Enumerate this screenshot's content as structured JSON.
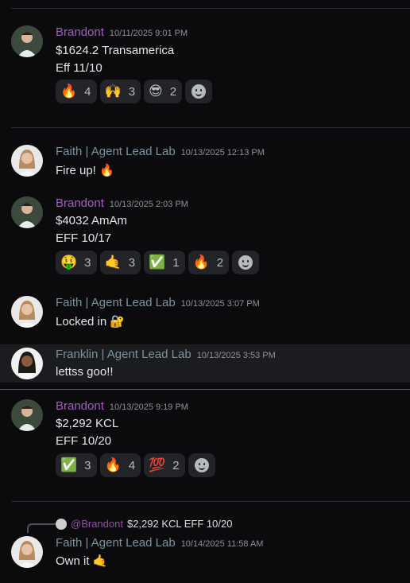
{
  "messages": [
    {
      "author": "Brandont",
      "time": "10/11/2025 9:01 PM",
      "lines": [
        "$1624.2 Transamerica",
        "Eff 11/10"
      ],
      "reactions": [
        {
          "emoji": "🔥",
          "count": "4"
        },
        {
          "emoji": "🙌",
          "count": "3"
        },
        {
          "emoji": "😎",
          "count": "2"
        }
      ]
    },
    {
      "author": "Faith | Agent Lead Lab",
      "time": "10/13/2025 12:13 PM",
      "lines": [
        "Fire up! 🔥"
      ]
    },
    {
      "author": "Brandont",
      "time": "10/13/2025 2:03 PM",
      "lines": [
        "$4032 AmAm",
        "EFF 10/17"
      ],
      "reactions": [
        {
          "emoji": "🤑",
          "count": "3"
        },
        {
          "emoji": "🤙",
          "count": "3"
        },
        {
          "emoji": "✅",
          "count": "1"
        },
        {
          "emoji": "🔥",
          "count": "2"
        }
      ]
    },
    {
      "author": "Faith | Agent Lead Lab",
      "time": "10/13/2025 3:07 PM",
      "lines": [
        "Locked in 🔐"
      ]
    },
    {
      "author": "Franklin | Agent Lead Lab",
      "time": "10/13/2025 3:53 PM",
      "lines": [
        "lettss goo!!"
      ]
    },
    {
      "author": "Brandont",
      "time": "10/13/2025 9:19 PM",
      "lines": [
        "$2,292 KCL",
        "EFF 10/20"
      ],
      "reactions": [
        {
          "emoji": "✅",
          "count": "3"
        },
        {
          "emoji": "🔥",
          "count": "4"
        },
        {
          "emoji": "💯",
          "count": "2"
        }
      ]
    },
    {
      "author": "Faith | Agent Lead Lab",
      "time": "10/14/2025 11:58 AM",
      "lines": [
        "Own it 🤙"
      ],
      "reply": {
        "user": "@Brandont",
        "text": "$2,292 KCL EFF 10/20"
      }
    }
  ],
  "colors": {
    "brandont": "#a35ebf",
    "agent": "#7a939e",
    "new_divider": "#c7323a"
  }
}
